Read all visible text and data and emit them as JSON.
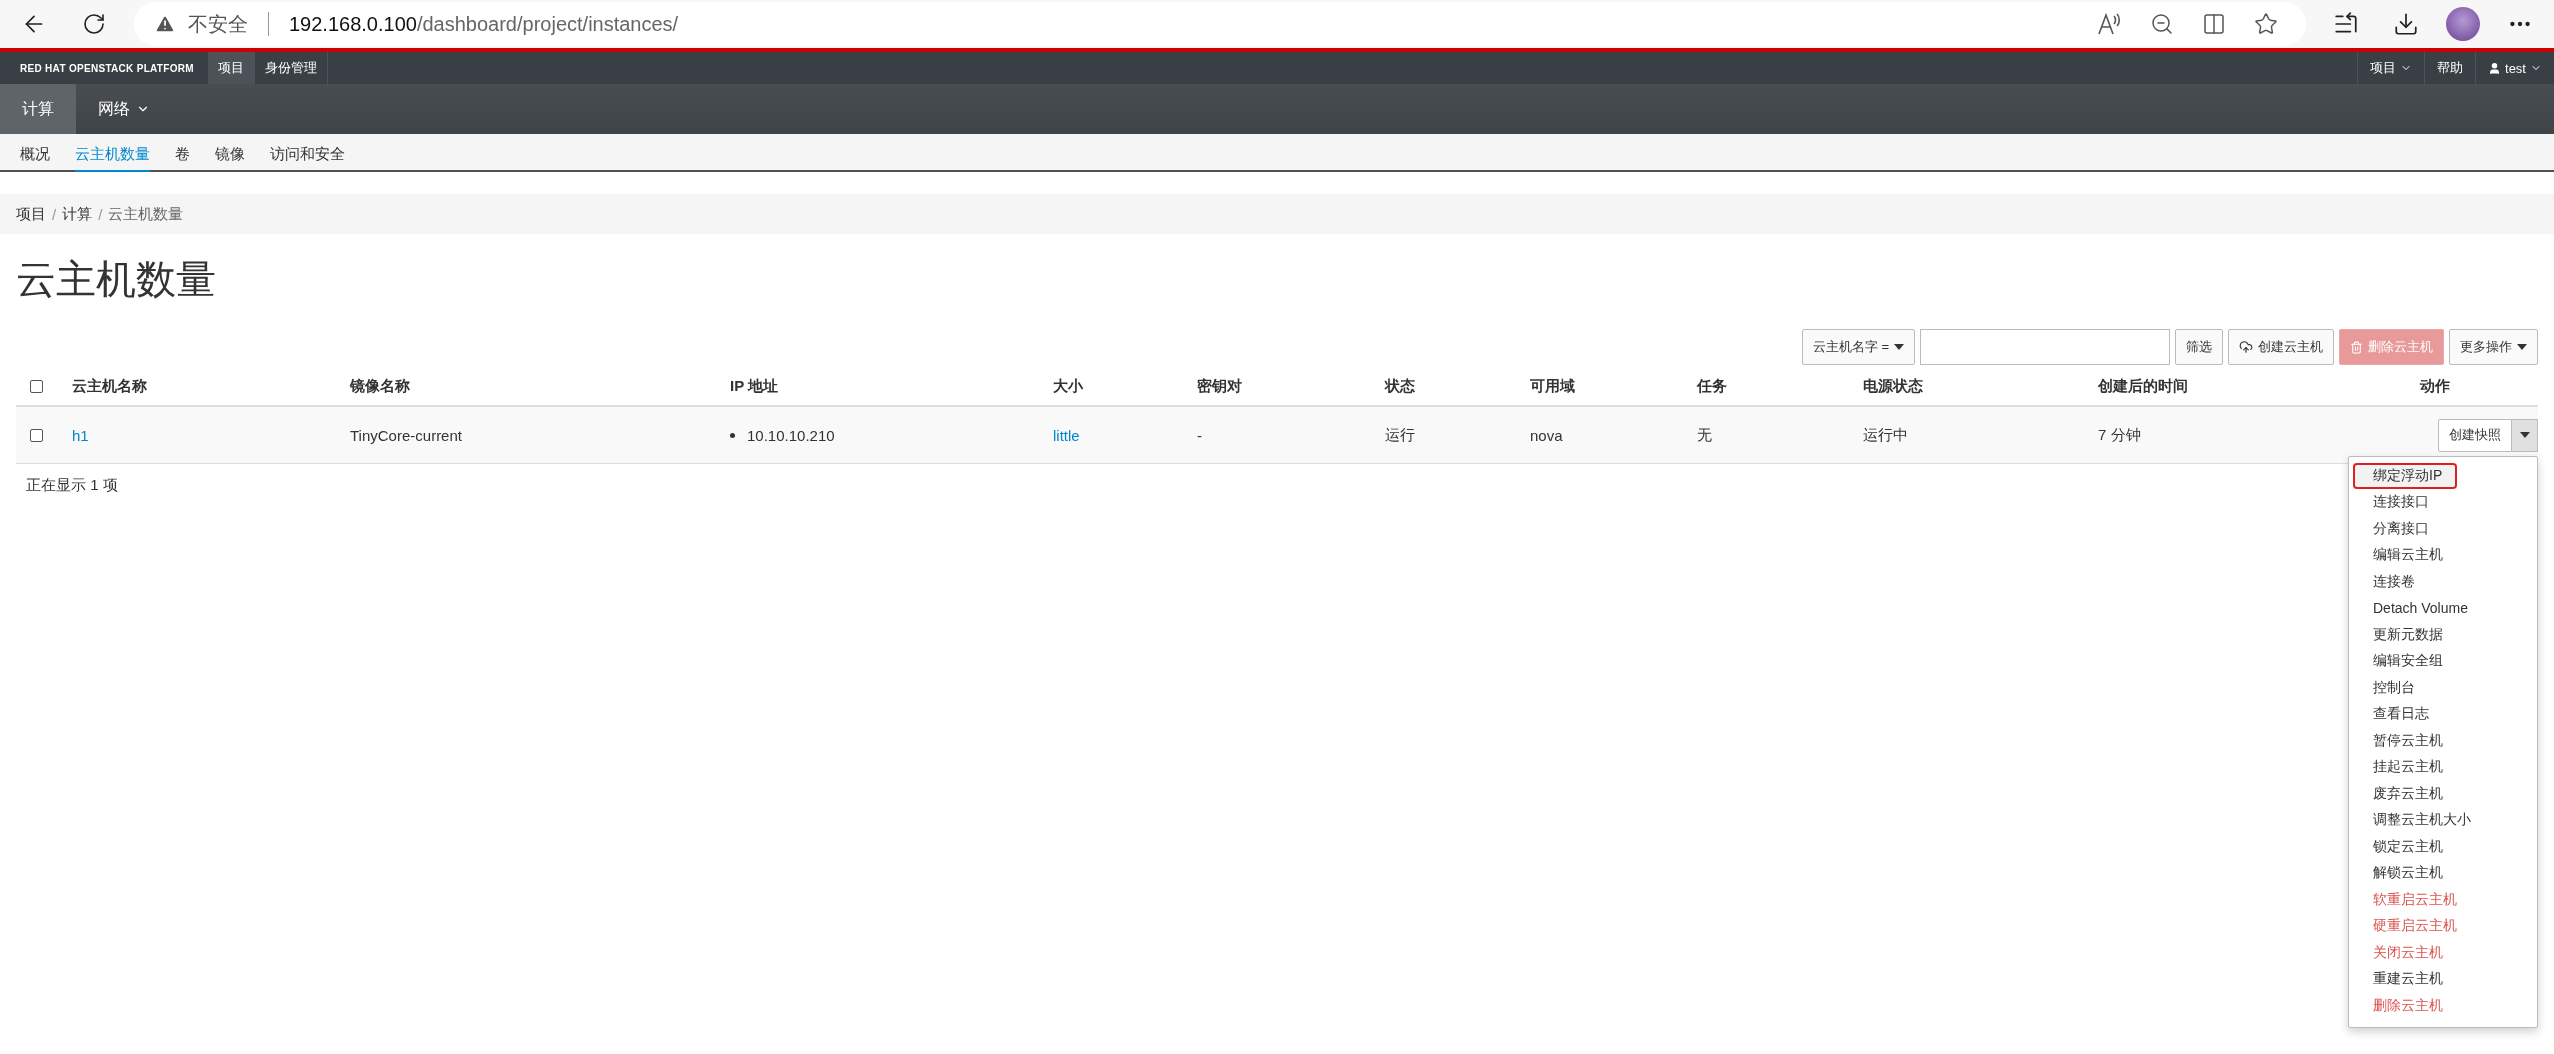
{
  "browser": {
    "security_label": "不安全",
    "url_host": "192.168.0.100",
    "url_path": "/dashboard/project/instances/"
  },
  "top_nav": {
    "brand": "RED HAT OPENSTACK PLATFORM",
    "tabs": [
      {
        "label": "项目",
        "selected": true
      },
      {
        "label": "身份管理",
        "selected": false
      }
    ],
    "right": [
      {
        "label": "项目",
        "kind": "dropdown"
      },
      {
        "label": "帮助",
        "kind": "link"
      },
      {
        "label": "test",
        "kind": "user"
      }
    ]
  },
  "section_nav": [
    {
      "label": "计算",
      "selected": true,
      "kind": "plain"
    },
    {
      "label": "网络",
      "selected": false,
      "kind": "dropdown"
    }
  ],
  "sub_nav": [
    {
      "label": "概况",
      "selected": false
    },
    {
      "label": "云主机数量",
      "selected": true
    },
    {
      "label": "卷",
      "selected": false
    },
    {
      "label": "镜像",
      "selected": false
    },
    {
      "label": "访问和安全",
      "selected": false
    }
  ],
  "breadcrumb": {
    "separator": "/",
    "items": [
      "项目",
      "计算",
      "云主机数量"
    ]
  },
  "title": "云主机数量",
  "toolbar": {
    "filter_field": "云主机名字 =",
    "filter_button": "筛选",
    "buttons": [
      {
        "label": "创建云主机",
        "kind": "create",
        "disabled": false
      },
      {
        "label": "删除云主机",
        "kind": "delete",
        "disabled": true
      },
      {
        "label": "更多操作",
        "kind": "more",
        "disabled": false
      }
    ]
  },
  "table": {
    "header_checked": false,
    "columns": [
      "云主机名称",
      "镜像名称",
      "IP 地址",
      "大小",
      "密钥对",
      "状态",
      "可用域",
      "任务",
      "电源状态",
      "创建后的时间",
      "动作"
    ],
    "rows": [
      {
        "checked": false,
        "cells": [
          {
            "text": "h1",
            "kind": "link"
          },
          {
            "text": "TinyCore-current",
            "kind": "text"
          },
          {
            "text": "10.10.10.210",
            "kind": "list"
          },
          {
            "text": "little",
            "kind": "link"
          },
          {
            "text": "-",
            "kind": "text"
          },
          {
            "text": "运行",
            "kind": "text"
          },
          {
            "text": "nova",
            "kind": "text"
          },
          {
            "text": "无",
            "kind": "text"
          },
          {
            "text": "运行中",
            "kind": "text"
          },
          {
            "text": "7 分钟",
            "kind": "text"
          }
        ],
        "action": "创建快照",
        "menu_open": true
      }
    ],
    "footer": "正在显示 1 项"
  },
  "menu": [
    {
      "label": "绑定浮动IP",
      "kind": "normal",
      "selected": true
    },
    {
      "label": "连接接口",
      "kind": "normal",
      "selected": false
    },
    {
      "label": "分离接口",
      "kind": "normal",
      "selected": false
    },
    {
      "label": "编辑云主机",
      "kind": "normal",
      "selected": false
    },
    {
      "label": "连接卷",
      "kind": "normal",
      "selected": false
    },
    {
      "label": "Detach Volume",
      "kind": "normal",
      "selected": false
    },
    {
      "label": "更新元数据",
      "kind": "normal",
      "selected": false
    },
    {
      "label": "编辑安全组",
      "kind": "normal",
      "selected": false
    },
    {
      "label": "控制台",
      "kind": "normal",
      "selected": false
    },
    {
      "label": "查看日志",
      "kind": "normal",
      "selected": false
    },
    {
      "label": "暂停云主机",
      "kind": "normal",
      "selected": false
    },
    {
      "label": "挂起云主机",
      "kind": "normal",
      "selected": false
    },
    {
      "label": "废弃云主机",
      "kind": "normal",
      "selected": false
    },
    {
      "label": "调整云主机大小",
      "kind": "normal",
      "selected": false
    },
    {
      "label": "锁定云主机",
      "kind": "normal",
      "selected": false
    },
    {
      "label": "解锁云主机",
      "kind": "normal",
      "selected": false
    },
    {
      "label": "软重启云主机",
      "kind": "danger",
      "selected": false
    },
    {
      "label": "硬重启云主机",
      "kind": "danger",
      "selected": false
    },
    {
      "label": "关闭云主机",
      "kind": "danger",
      "selected": false
    },
    {
      "label": "重建云主机",
      "kind": "normal",
      "selected": false
    },
    {
      "label": "删除云主机",
      "kind": "danger",
      "selected": false
    }
  ]
}
